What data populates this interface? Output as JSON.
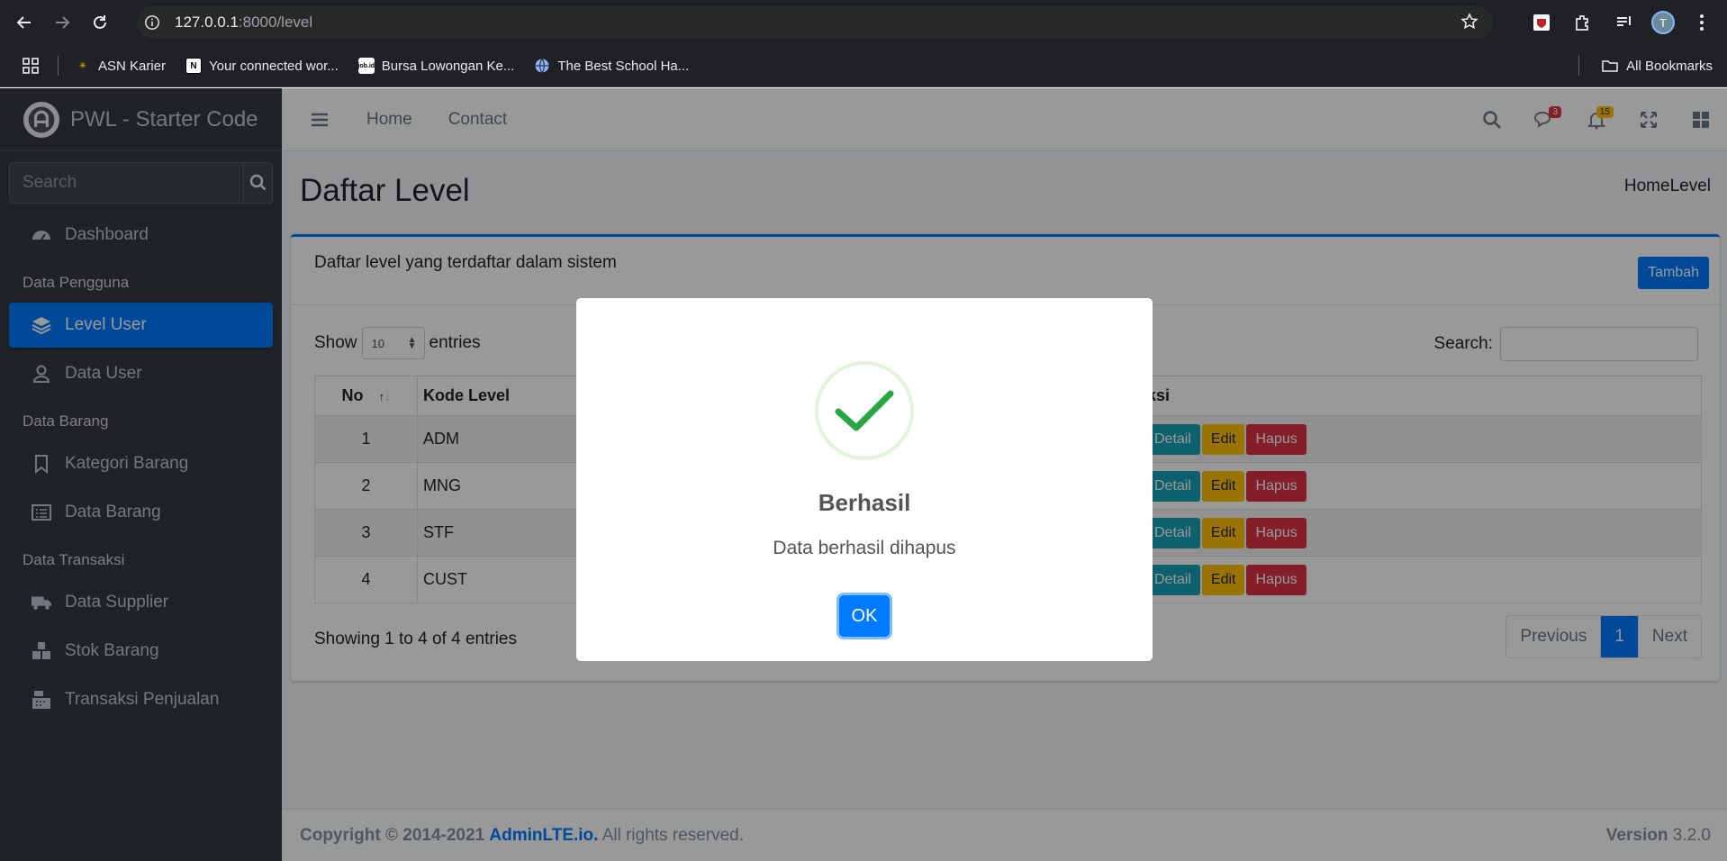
{
  "browser": {
    "url_host": "127.0.0.1",
    "url_rest": ":8000/level",
    "avatar_letter": "T",
    "bookmarks": [
      {
        "label": "ASN Karier"
      },
      {
        "label": "Your connected wor..."
      },
      {
        "label": "Bursa Lowongan Ke..."
      },
      {
        "label": "The Best School Ha..."
      }
    ],
    "all_bookmarks": "All Bookmarks"
  },
  "sidebar": {
    "brand": "PWL - Starter Code",
    "search_placeholder": "Search",
    "dashboard": "Dashboard",
    "header_pengguna": "Data Pengguna",
    "level_user": "Level User",
    "data_user": "Data User",
    "header_barang": "Data Barang",
    "kategori_barang": "Kategori Barang",
    "data_barang": "Data Barang",
    "header_transaksi": "Data Transaksi",
    "data_supplier": "Data Supplier",
    "stok_barang": "Stok Barang",
    "transaksi_penjualan": "Transaksi Penjualan"
  },
  "topnav": {
    "home": "Home",
    "contact": "Contact",
    "messages_badge": "3",
    "notifications_badge": "15"
  },
  "content": {
    "page_title": "Daftar Level",
    "breadcrumb": "HomeLevel",
    "card_title": "Daftar level yang terdaftar dalam sistem",
    "tambah_label": "Tambah",
    "show_label": "Show",
    "entries_value": "10",
    "entries_label": "entries",
    "search_label": "Search:",
    "columns": {
      "no": "No",
      "kode": "Kode Level",
      "aksi": "ksi"
    },
    "rows": [
      {
        "no": "1",
        "kode": "ADM"
      },
      {
        "no": "2",
        "kode": "MNG"
      },
      {
        "no": "3",
        "kode": "STF"
      },
      {
        "no": "4",
        "kode": "CUST"
      }
    ],
    "btn_detail": "Detail",
    "btn_edit": "Edit",
    "btn_hapus": "Hapus",
    "showing": "Showing 1 to 4 of 4 entries",
    "pager": {
      "previous": "Previous",
      "current": "1",
      "next": "Next"
    }
  },
  "footer": {
    "copyright": "Copyright © 2014-2021",
    "brand_link": "AdminLTE.io.",
    "rights": "All rights reserved.",
    "version_label": "Version",
    "version": "3.2.0"
  },
  "modal": {
    "title": "Berhasil",
    "text": "Data berhasil dihapus",
    "ok_label": "OK",
    "accent": "#28a745"
  }
}
